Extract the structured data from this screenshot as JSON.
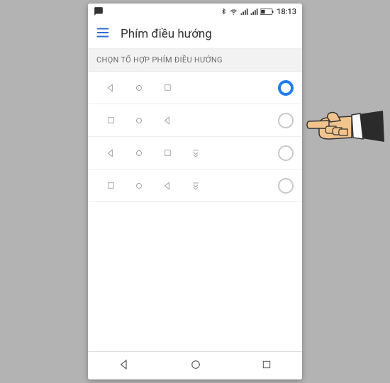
{
  "status": {
    "time": "18:13"
  },
  "app": {
    "title": "Phím điều hướng"
  },
  "section": {
    "header": "CHỌN TỔ HỢP PHÍM ĐIỀU HƯỚNG"
  },
  "rows": [
    {
      "icons": [
        "back",
        "circle",
        "square",
        null
      ],
      "selected": true
    },
    {
      "icons": [
        "square",
        "circle",
        "back",
        null
      ],
      "selected": false
    },
    {
      "icons": [
        "back",
        "circle",
        "square",
        "pull"
      ],
      "selected": false
    },
    {
      "icons": [
        "square",
        "circle",
        "back",
        "pull"
      ],
      "selected": false
    }
  ]
}
